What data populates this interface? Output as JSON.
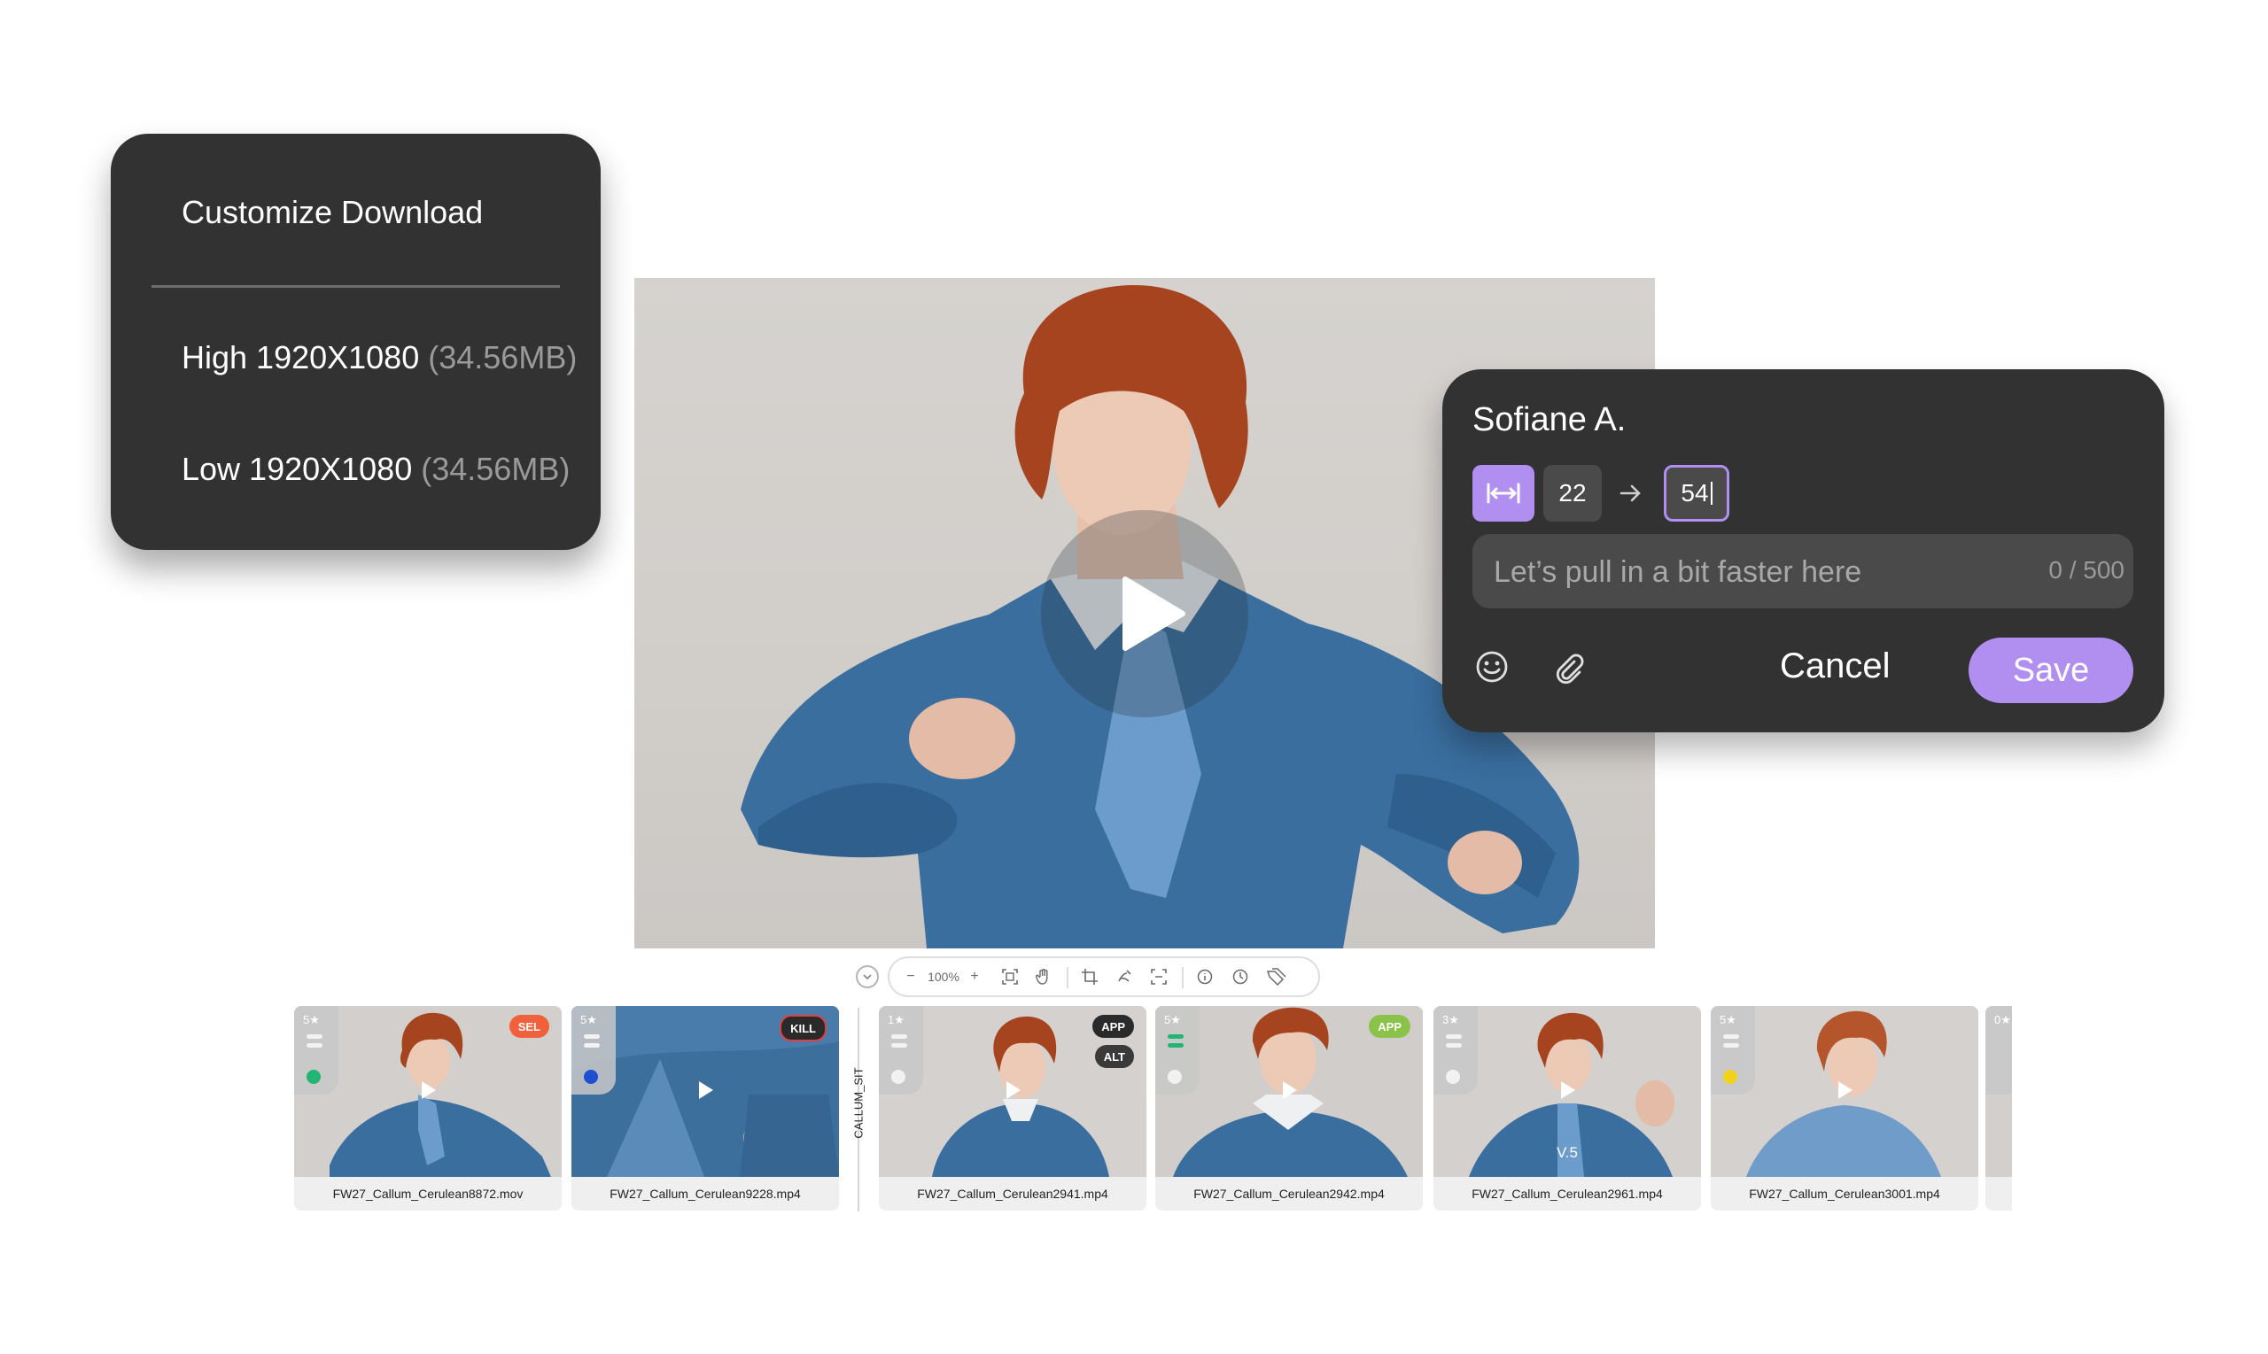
{
  "download_menu": {
    "title": "Customize Download",
    "options": [
      {
        "label": "High 1920X1080",
        "size": "(34.56MB)"
      },
      {
        "label": "Low 1920X1080",
        "size": "(34.56MB)"
      }
    ]
  },
  "viewer": {
    "play_icon": "play-icon"
  },
  "toolbar": {
    "zoom": "100%",
    "zoom_out": "−",
    "zoom_in": "+",
    "icons": [
      "chevron-down-icon",
      "fit-screen-icon",
      "hand-icon",
      "crop-icon",
      "draw-icon",
      "focus-icon",
      "info-icon",
      "clock-icon",
      "tags-icon"
    ]
  },
  "comment": {
    "author": "Sofiane A.",
    "tc_start": "22",
    "tc_end": "54",
    "placeholder": "Let’s pull in a bit faster here",
    "counter": "0 / 500",
    "cancel_label": "Cancel",
    "save_label": "Save",
    "accent": "#b18ff0"
  },
  "filmstrip": {
    "group_label": "CALLUM_SIT",
    "items": [
      {
        "rating": "5★",
        "tag": "SEL",
        "filename": "FW27_Callum_Cerulean8872.mov",
        "status": "green"
      },
      {
        "rating": "5★",
        "tag": "KILL",
        "filename": "FW27_Callum_Cerulean9228.mp4",
        "status": "blue"
      },
      {
        "rating": "1★",
        "tag": "APP",
        "tag2": "ALT",
        "filename": "FW27_Callum_Cerulean2941.mp4"
      },
      {
        "rating": "5★",
        "tag": "APP",
        "filename": "FW27_Callum_Cerulean2942.mp4"
      },
      {
        "rating": "3★",
        "filename": "FW27_Callum_Cerulean2961.mp4",
        "version": "V.5"
      },
      {
        "rating": "5★",
        "filename": "FW27_Callum_Cerulean3001.mp4",
        "status": "yellow"
      },
      {
        "rating": "0★"
      }
    ]
  }
}
